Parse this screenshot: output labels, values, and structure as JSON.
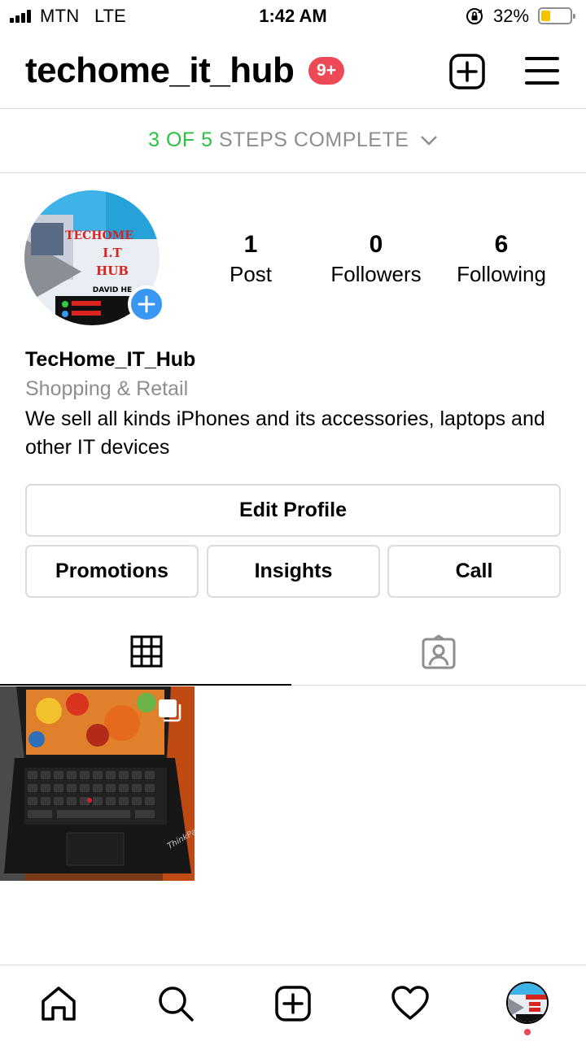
{
  "status_bar": {
    "carrier": "MTN",
    "network": "LTE",
    "time": "1:42 AM",
    "battery_percent": "32%",
    "battery_level": 0.32,
    "icons": [
      "signal-bars-icon",
      "rotation-lock-icon",
      "battery-icon"
    ]
  },
  "header": {
    "username": "techome_it_hub",
    "notification_badge": "9+",
    "icons": [
      "new-post-icon",
      "menu-icon"
    ]
  },
  "steps": {
    "progress": "3 OF 5",
    "label": "STEPS COMPLETE"
  },
  "profile": {
    "avatar_text": {
      "line1": "TECHOME",
      "line2": "I.T",
      "line3": "HUB",
      "line4": "DAVID HE"
    },
    "stats": [
      {
        "value": "1",
        "label": "Post"
      },
      {
        "value": "0",
        "label": "Followers"
      },
      {
        "value": "6",
        "label": "Following"
      }
    ],
    "name": "TecHome_IT_Hub",
    "category": "Shopping & Retail",
    "bio": "We sell all kinds iPhones and its accessories, laptops and other IT devices"
  },
  "buttons": {
    "edit_profile": "Edit Profile",
    "promotions": "Promotions",
    "insights": "Insights",
    "call": "Call"
  },
  "tabs": {
    "active": "grid",
    "icons": [
      "grid-icon",
      "tagged-icon"
    ]
  },
  "post": {
    "keyboard_brand": "ThinkPad"
  },
  "bottom_nav": {
    "icons": [
      "home-icon",
      "search-icon",
      "create-icon",
      "activity-heart-icon",
      "profile-avatar"
    ],
    "colors": {
      "notification_dot": "#ed4956",
      "accent": "#3897f0",
      "progress_green": "#2ac140"
    }
  }
}
